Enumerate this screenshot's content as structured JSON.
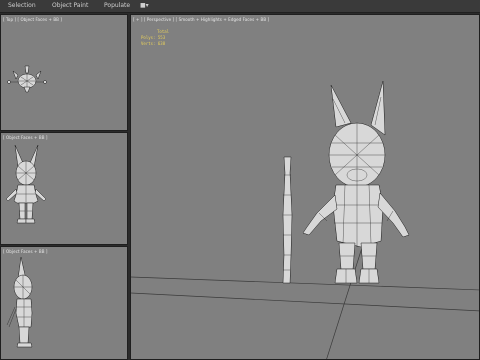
{
  "menu": {
    "items": [
      {
        "label": "Selection"
      },
      {
        "label": "Object Paint"
      },
      {
        "label": "Populate"
      }
    ],
    "flag_icon": "flag-icon"
  },
  "viewports": {
    "top": {
      "label": "[ Top ] [ Object Faces + BB ]"
    },
    "front": {
      "label": "[ Object Faces + BB ]"
    },
    "left": {
      "label": "[ Object Faces + BB ]"
    },
    "perspective": {
      "label": "[ + ] [ Perspective ] [ Smooth + Highlights + Edged Faces + BB ]",
      "stats": {
        "total_label": "Total",
        "polys_label": "Polys:",
        "polys_value": "553",
        "verts_label": "Verts:",
        "verts_value": "638"
      }
    }
  },
  "colors": {
    "viewport_bg": "#808080",
    "app_bg": "#2b2b2b",
    "stats_text": "#e8d05a"
  }
}
